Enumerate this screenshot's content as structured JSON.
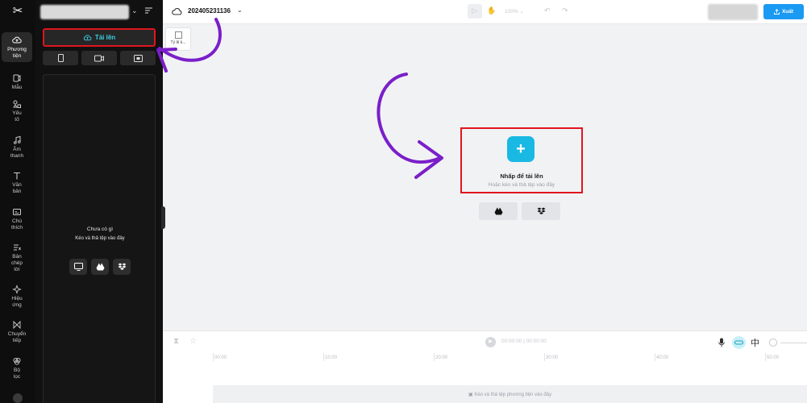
{
  "rail": {
    "items": [
      {
        "label": "Phương tiện",
        "lines": [
          "Phương",
          "tiện"
        ]
      },
      {
        "label": "Mẫu",
        "lines": [
          "Mẫu"
        ]
      },
      {
        "label": "Yếu tố",
        "lines": [
          "Yếu",
          "tố"
        ]
      },
      {
        "label": "Âm thanh",
        "lines": [
          "Âm",
          "thanh"
        ]
      },
      {
        "label": "Văn bản",
        "lines": [
          "Văn",
          "bản"
        ]
      },
      {
        "label": "Chú thích",
        "lines": [
          "Chú",
          "thích"
        ]
      },
      {
        "label": "Bản chép lời",
        "lines": [
          "Bản",
          "chép",
          "lời"
        ]
      },
      {
        "label": "Hiệu ứng",
        "lines": [
          "Hiệu",
          "ứng"
        ]
      },
      {
        "label": "Chuyển tiếp",
        "lines": [
          "Chuyển",
          "tiếp"
        ]
      },
      {
        "label": "Bộ lọc",
        "lines": [
          "Bộ",
          "lọc"
        ]
      }
    ]
  },
  "panel": {
    "upload_label": "Tải lên",
    "empty_title": "Chưa có gì",
    "empty_subtitle": "Kéo và thả tệp vào đây"
  },
  "topbar": {
    "project_title": "202405231136",
    "zoom": "100%",
    "export_label": "Xuất"
  },
  "canvas": {
    "ratio_label": "Tỷ lệ k...",
    "upload_title": "Nhấp để tải lên",
    "upload_subtitle": "Hoặc kéo và thả tệp vào đây"
  },
  "timeline": {
    "time": "00:00:00 | 00:00:00",
    "ticks": [
      "00:00",
      "10:00",
      "20:00",
      "30:00",
      "40:00",
      "50:00"
    ],
    "track_hint": "Kéo và thả tệp phương tiện vào đây"
  },
  "colors": {
    "accent": "#19b9e4",
    "export": "#1a9af2",
    "highlight_box": "#e0151f",
    "annotation_arrow": "#7a1fc9"
  }
}
